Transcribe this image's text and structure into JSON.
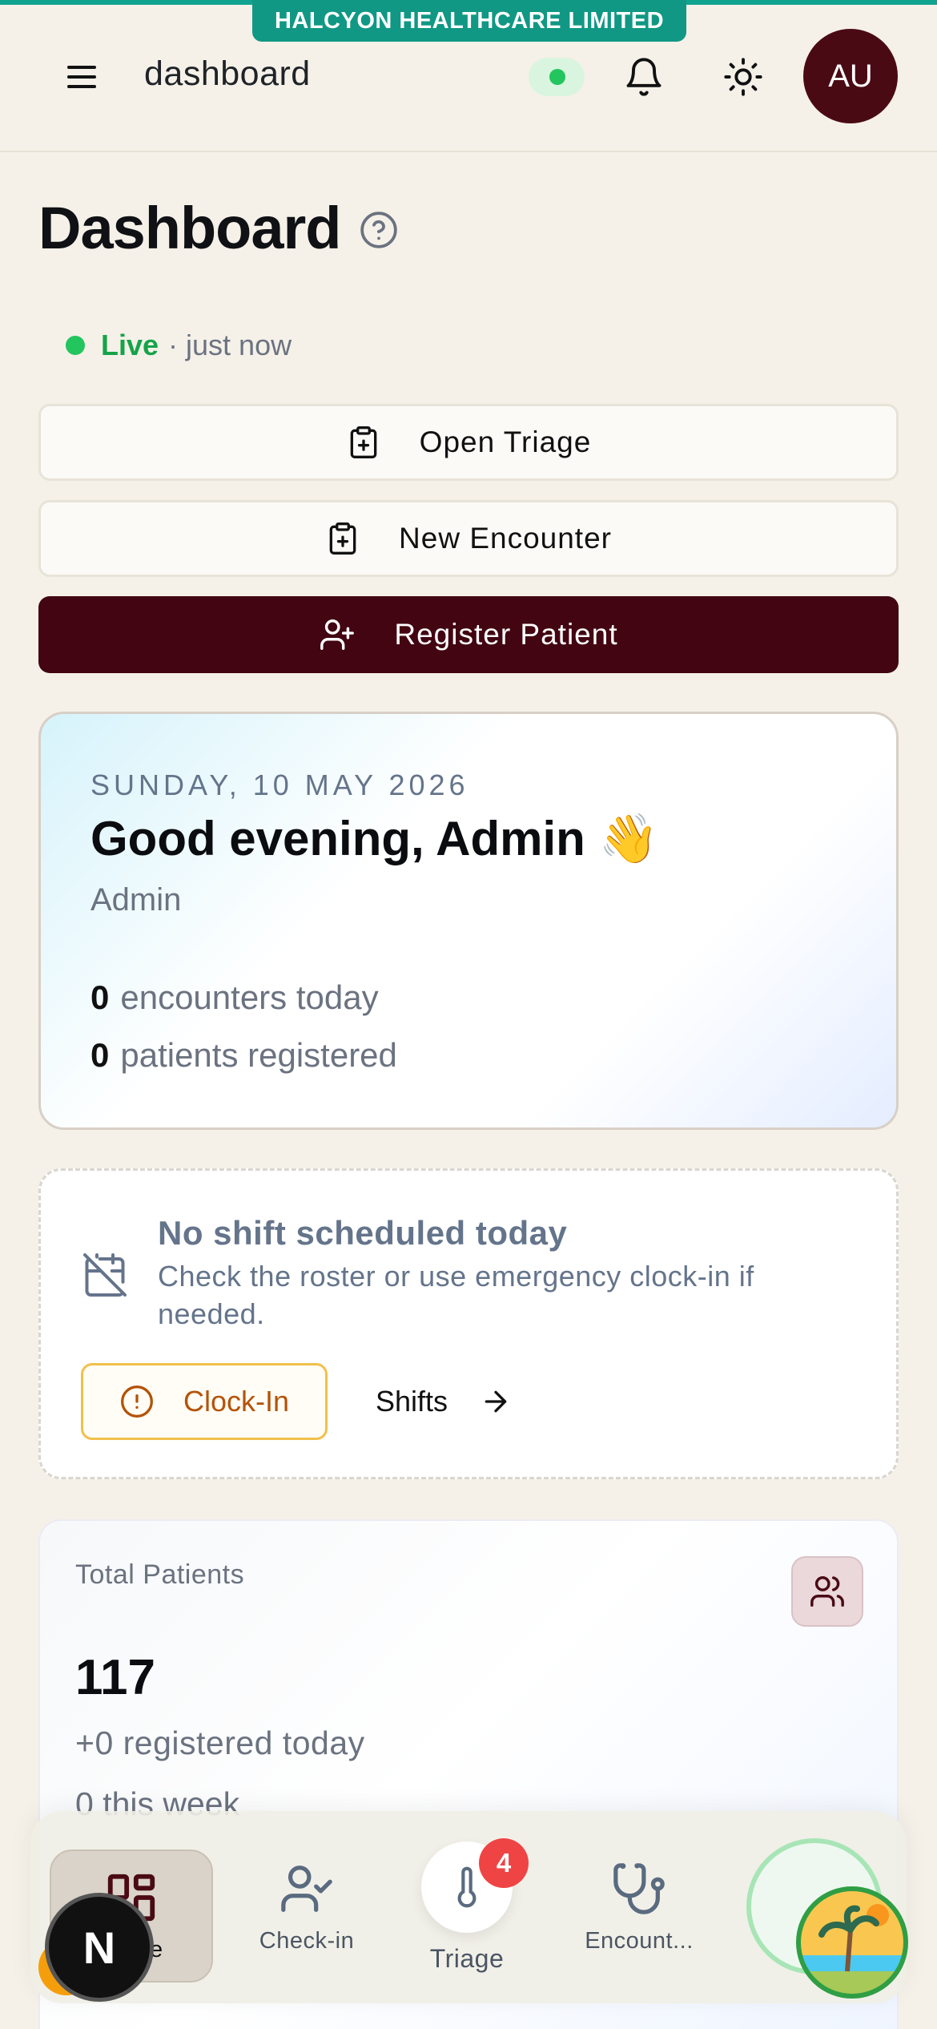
{
  "organization": "HALCYON HEALTHCARE LIMITED",
  "header": {
    "title": "dashboard",
    "avatar_initials": "AU",
    "connection_status_color": "#22c55e"
  },
  "page": {
    "title": "Dashboard",
    "live_label": "Live",
    "live_time": "· just now"
  },
  "actions": {
    "open_triage": "Open Triage",
    "new_encounter": "New Encounter",
    "register_patient": "Register Patient"
  },
  "greeting": {
    "date": "SUNDAY, 10 MAY 2026",
    "title": "Good evening, Admin 👋",
    "role": "Admin",
    "encounters_count": "0",
    "encounters_label": "encounters today",
    "patients_count": "0",
    "patients_label": "patients registered"
  },
  "shift": {
    "title": "No shift scheduled today",
    "subtitle": "Check the roster or use emergency clock-in if needed.",
    "clock_in_label": "Clock-In",
    "shifts_label": "Shifts"
  },
  "total_patients": {
    "label": "Total Patients",
    "value": "117",
    "today": "+0 registered today",
    "week": "0 this week"
  },
  "bottom_nav": {
    "home": "Home",
    "check_in": "Check-in",
    "triage": "Triage",
    "triage_badge": "4",
    "encounters": "Encount..."
  },
  "colors": {
    "brand": "#420511",
    "accent_teal": "#109884",
    "live_green": "#16a34a",
    "badge_red": "#ef4444"
  },
  "icons": [
    "menu-icon",
    "bell-icon",
    "sun-icon",
    "help-icon",
    "clipboard-plus-icon",
    "user-plus-icon",
    "calendar-off-icon",
    "alert-circle-icon",
    "arrow-right-icon",
    "users-icon",
    "dashboard-icon",
    "user-check-icon",
    "thermometer-icon",
    "stethoscope-icon"
  ]
}
